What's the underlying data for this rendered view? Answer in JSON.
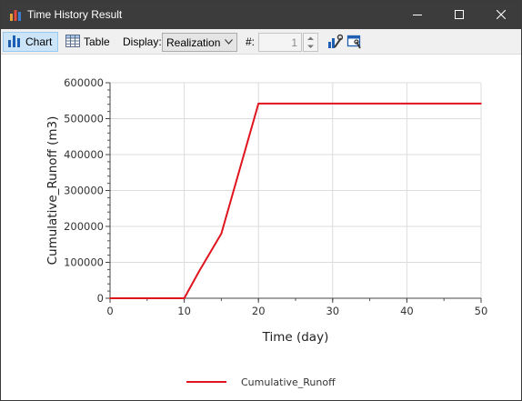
{
  "window": {
    "title": "Time History Result"
  },
  "toolbar": {
    "chart_label": "Chart",
    "table_label": "Table",
    "display_label": "Display:",
    "display_value": "Realization",
    "num_label": "#:",
    "num_value": "1"
  },
  "colors": {
    "series": "#e0141e",
    "titlebar": "#3c3c3c",
    "active_tab": "#cce4f7"
  },
  "chart_data": {
    "type": "line",
    "xlabel": "Time (day)",
    "ylabel": "Cumulative_Runoff (m3)",
    "xlim": [
      0,
      50
    ],
    "ylim": [
      0,
      600000
    ],
    "x_ticks": [
      "0",
      "10",
      "20",
      "30",
      "40",
      "50"
    ],
    "y_ticks": [
      "0",
      "100000",
      "200000",
      "300000",
      "400000",
      "500000",
      "600000"
    ],
    "grid": true,
    "legend_position": "bottom-center",
    "series": [
      {
        "name": "Cumulative_Runoff",
        "color": "#e0141e",
        "x": [
          0,
          10,
          12,
          15,
          20,
          50
        ],
        "y": [
          0,
          0,
          75000,
          180000,
          542000,
          542000
        ]
      }
    ]
  }
}
